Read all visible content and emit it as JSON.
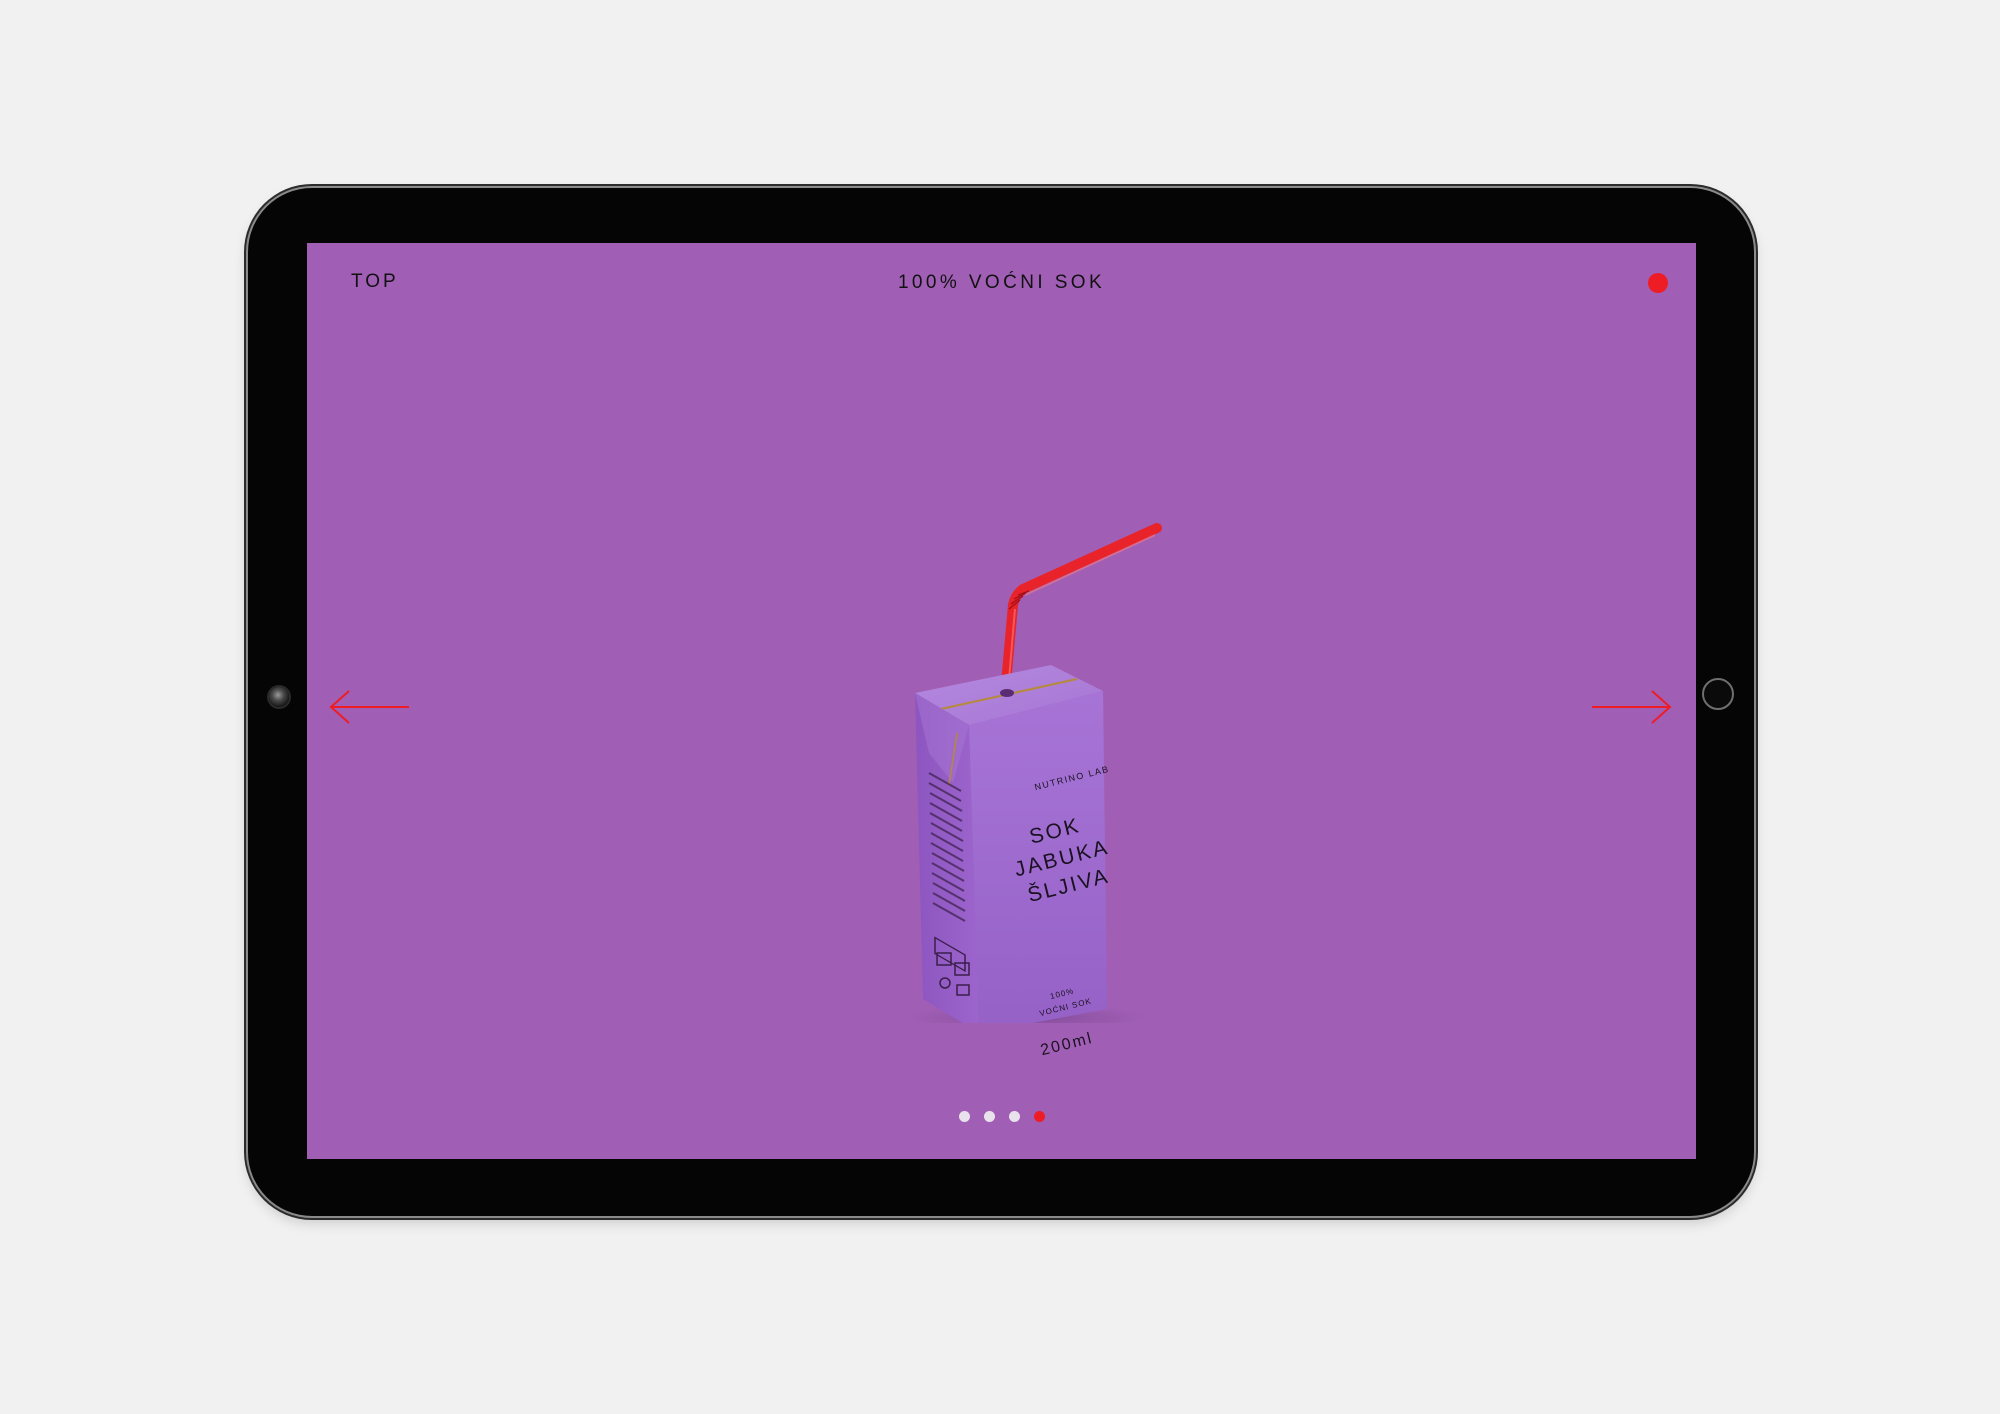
{
  "header": {
    "top_link": "TOP",
    "title": "100% VOĆNI SOK",
    "menu_icon": "red-dot-menu-icon"
  },
  "navigation": {
    "prev_icon": "arrow-left-icon",
    "next_icon": "arrow-right-icon"
  },
  "product": {
    "brand": "NUTRINO LAB",
    "flavor_lines": [
      "SOK",
      "JABUKA",
      "ŠLJIVA"
    ],
    "juice_lines": [
      "100%",
      "VOĆNI SOK"
    ],
    "volume": "200ml"
  },
  "pager": {
    "count": 4,
    "active_index": 3
  },
  "colors": {
    "page_background": "#f1f1f1",
    "screen_background": "#a05fb5",
    "accent": "#ee1c25",
    "carton": "#9d68cf",
    "text": "#111111"
  }
}
